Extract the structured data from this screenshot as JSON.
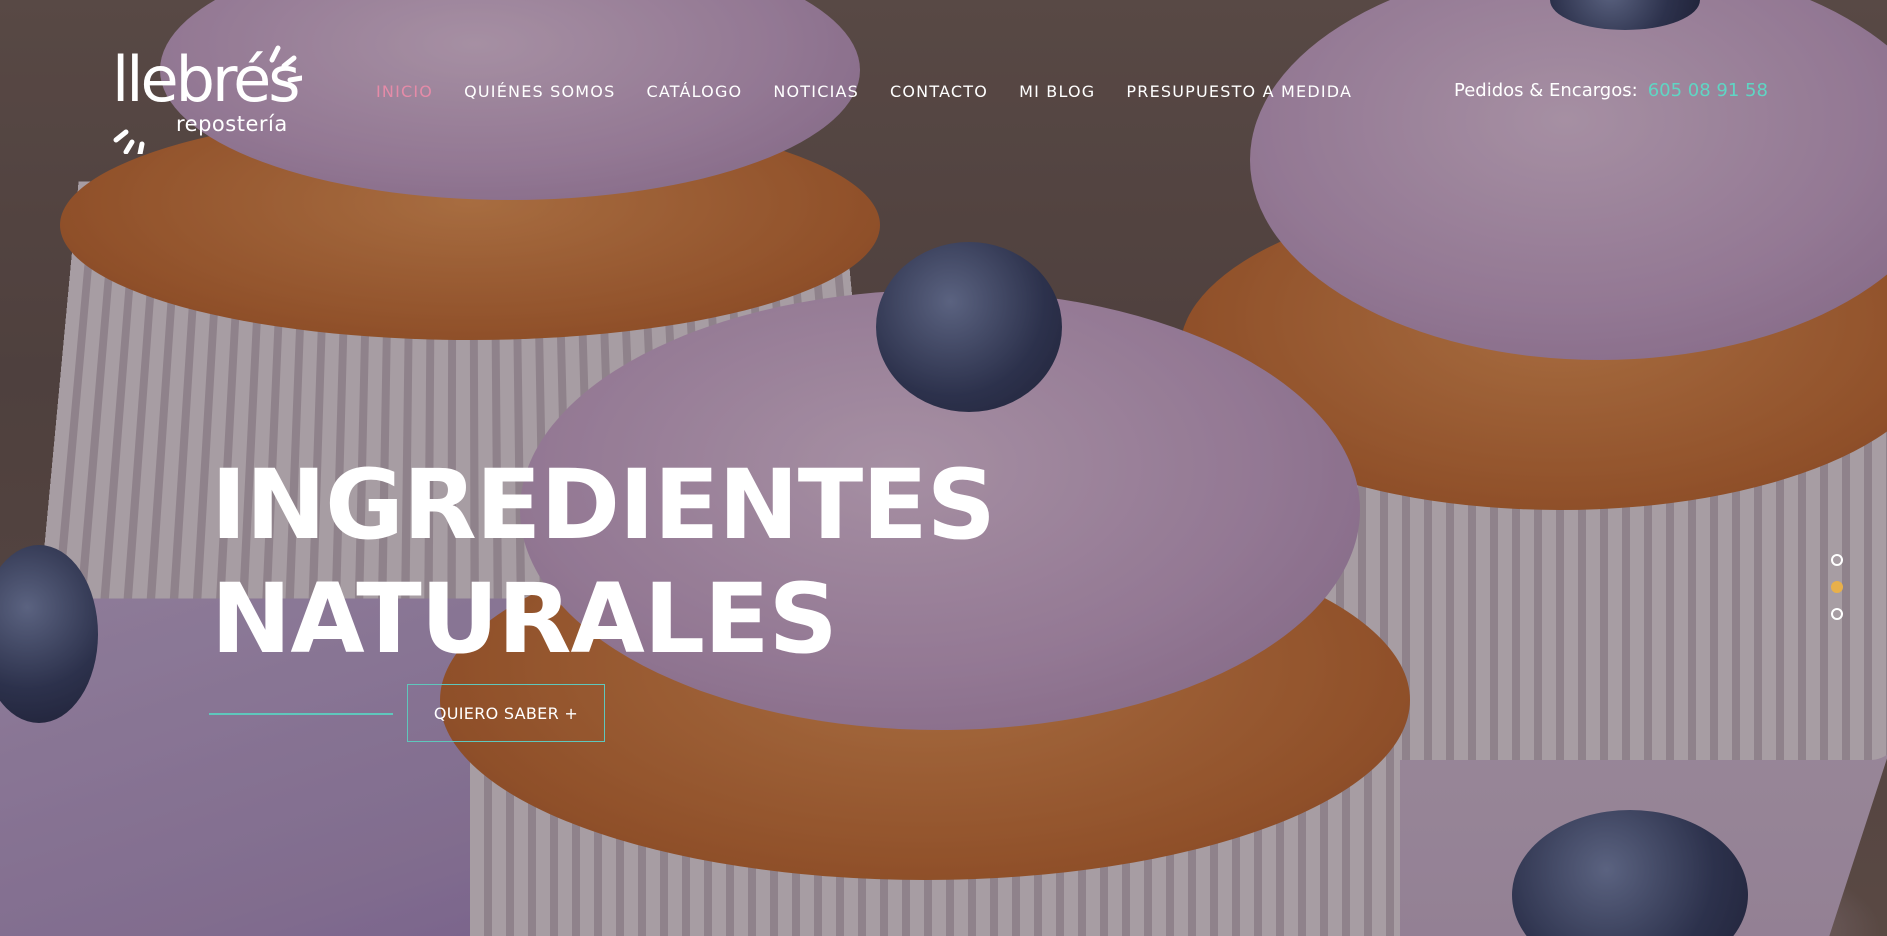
{
  "brand": {
    "name": "llebrés",
    "tagline": "repostería"
  },
  "nav": {
    "items": [
      {
        "label": "INICIO",
        "active": true
      },
      {
        "label": "QUIÉNES SOMOS",
        "active": false
      },
      {
        "label": "CATÁLOGO",
        "active": false
      },
      {
        "label": "NOTICIAS",
        "active": false
      },
      {
        "label": "CONTACTO",
        "active": false
      },
      {
        "label": "MI BLOG",
        "active": false
      },
      {
        "label": "PRESUPUESTO A MEDIDA",
        "active": false
      }
    ]
  },
  "orders": {
    "label": "Pedidos & Encargos:",
    "phone": "605 08 91 58"
  },
  "hero": {
    "headline_line1": "INGREDIENTES",
    "headline_line2": "NATURALES",
    "cta_label": "QUIERO SABER +"
  },
  "slider": {
    "total": 3,
    "active_index": 1
  },
  "colors": {
    "accent_teal": "#5fc7bc",
    "active_nav_pink": "#e58ba8",
    "active_dot": "#e8b04a",
    "phone": "#5fd6c4"
  }
}
